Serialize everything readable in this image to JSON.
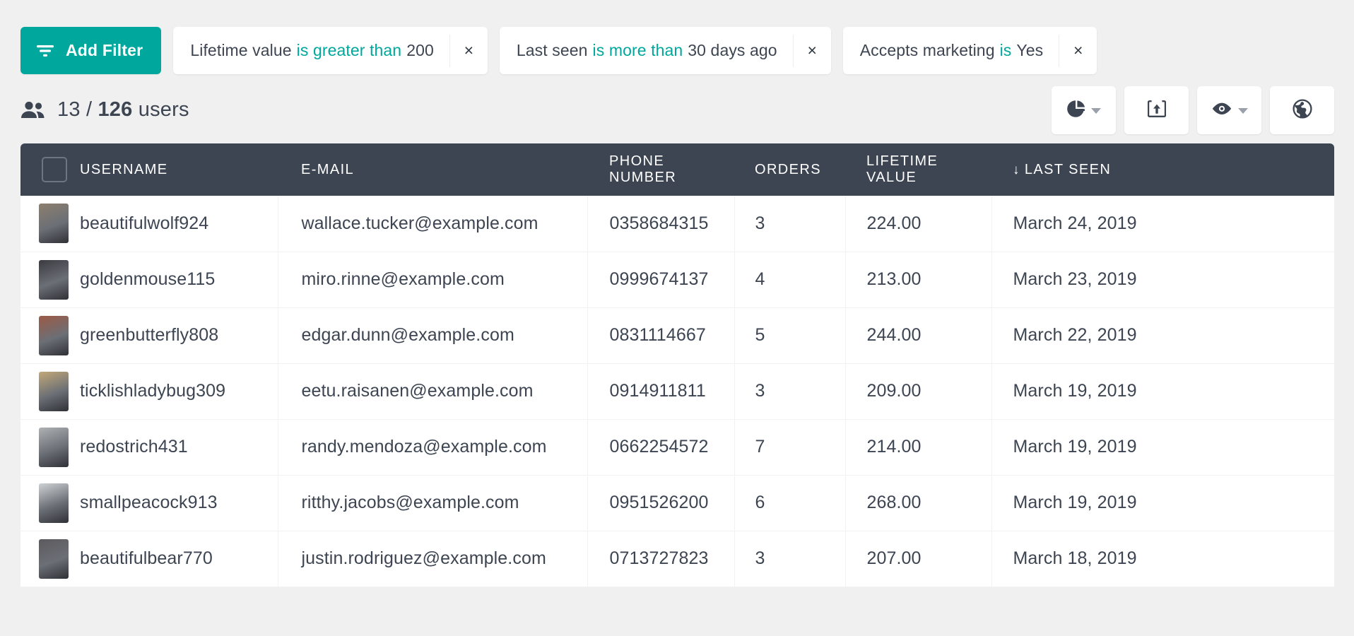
{
  "colors": {
    "accent": "#00a79d",
    "header_bg": "#3d4552",
    "page_bg": "#f0f0f0",
    "text": "#3d4552"
  },
  "filter_bar": {
    "add_filter_label": "Add Filter",
    "add_filter_icon": "filter-icon",
    "chips": [
      {
        "field": "Lifetime value",
        "operator": "is greater than",
        "value": "200",
        "remove_label": "×"
      },
      {
        "field": "Last seen",
        "operator": "is more than",
        "value": "30 days ago",
        "remove_label": "×"
      },
      {
        "field": "Accepts marketing",
        "operator": "is",
        "value": "Yes",
        "remove_label": "×"
      }
    ]
  },
  "count_row": {
    "users_icon": "users-icon",
    "shown": "13",
    "separator": "/",
    "total": "126",
    "noun": "users",
    "toolbar": [
      {
        "name": "chart-view-button",
        "icon": "pie-chart-icon",
        "has_caret": true
      },
      {
        "name": "export-button",
        "icon": "export-box-icon",
        "has_caret": false
      },
      {
        "name": "visibility-button",
        "icon": "eye-icon",
        "has_caret": true
      },
      {
        "name": "globe-button",
        "icon": "globe-icon",
        "has_caret": false
      }
    ]
  },
  "table": {
    "select_all_checked": false,
    "sort_indicator": "↓",
    "sorted_column": "LAST SEEN",
    "columns": [
      {
        "key": "checkbox",
        "label": ""
      },
      {
        "key": "username",
        "label": "USERNAME"
      },
      {
        "key": "email",
        "label": "E-MAIL"
      },
      {
        "key": "phone",
        "label": "PHONE NUMBER"
      },
      {
        "key": "orders",
        "label": "ORDERS"
      },
      {
        "key": "lifetime_value",
        "label": "LIFETIME VALUE"
      },
      {
        "key": "last_seen",
        "label": "LAST SEEN"
      }
    ],
    "rows": [
      {
        "username": "beautifulwolf924",
        "email": "wallace.tucker@example.com",
        "phone": "0358684315",
        "orders": "3",
        "lifetime_value": "224.00",
        "last_seen": "March 24, 2019",
        "avatar_tone": "#8d7f6e"
      },
      {
        "username": "goldenmouse115",
        "email": "miro.rinne@example.com",
        "phone": "0999674137",
        "orders": "4",
        "lifetime_value": "213.00",
        "last_seen": "March 23, 2019",
        "avatar_tone": "#3c3a41"
      },
      {
        "username": "greenbutterfly808",
        "email": "edgar.dunn@example.com",
        "phone": "0831114667",
        "orders": "5",
        "lifetime_value": "244.00",
        "last_seen": "March 22, 2019",
        "avatar_tone": "#9c5a45"
      },
      {
        "username": "ticklishladybug309",
        "email": "eetu.raisanen@example.com",
        "phone": "0914911811",
        "orders": "3",
        "lifetime_value": "209.00",
        "last_seen": "March 19, 2019",
        "avatar_tone": "#c2a878"
      },
      {
        "username": "redostrich431",
        "email": "randy.mendoza@example.com",
        "phone": "0662254572",
        "orders": "7",
        "lifetime_value": "214.00",
        "last_seen": "March 19, 2019",
        "avatar_tone": "#aeb2b4"
      },
      {
        "username": "smallpeacock913",
        "email": "ritthy.jacobs@example.com",
        "phone": "0951526200",
        "orders": "6",
        "lifetime_value": "268.00",
        "last_seen": "March 19, 2019",
        "avatar_tone": "#cfd2d4"
      },
      {
        "username": "beautifulbear770",
        "email": "justin.rodriguez@example.com",
        "phone": "0713727823",
        "orders": "3",
        "lifetime_value": "207.00",
        "last_seen": "March 18, 2019",
        "avatar_tone": "#5d5a5e"
      }
    ]
  }
}
